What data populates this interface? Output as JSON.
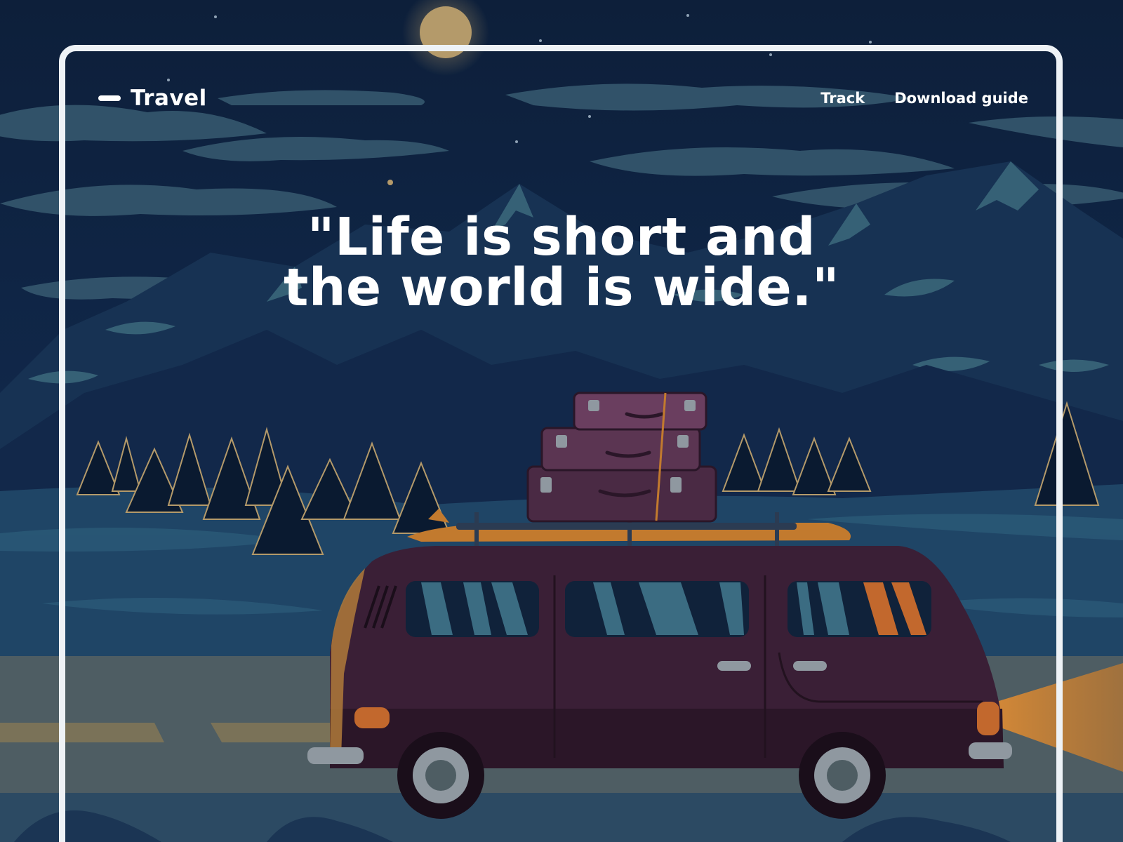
{
  "header": {
    "brand": "Travel",
    "nav": [
      {
        "label": "Track"
      },
      {
        "label": "Download guide"
      }
    ]
  },
  "hero": {
    "quote_line1": "\"Life is short and",
    "quote_line2": "the world is wide.\""
  },
  "colors": {
    "sky": "#0f2340",
    "mountain": "#1c3a5c",
    "snow": "#3f6f80",
    "van": "#3a1f36",
    "road": "#4e5d63",
    "frame": "#eef2f6"
  },
  "icons": [
    "brand-dash-icon",
    "moon-icon",
    "van-illustration"
  ]
}
